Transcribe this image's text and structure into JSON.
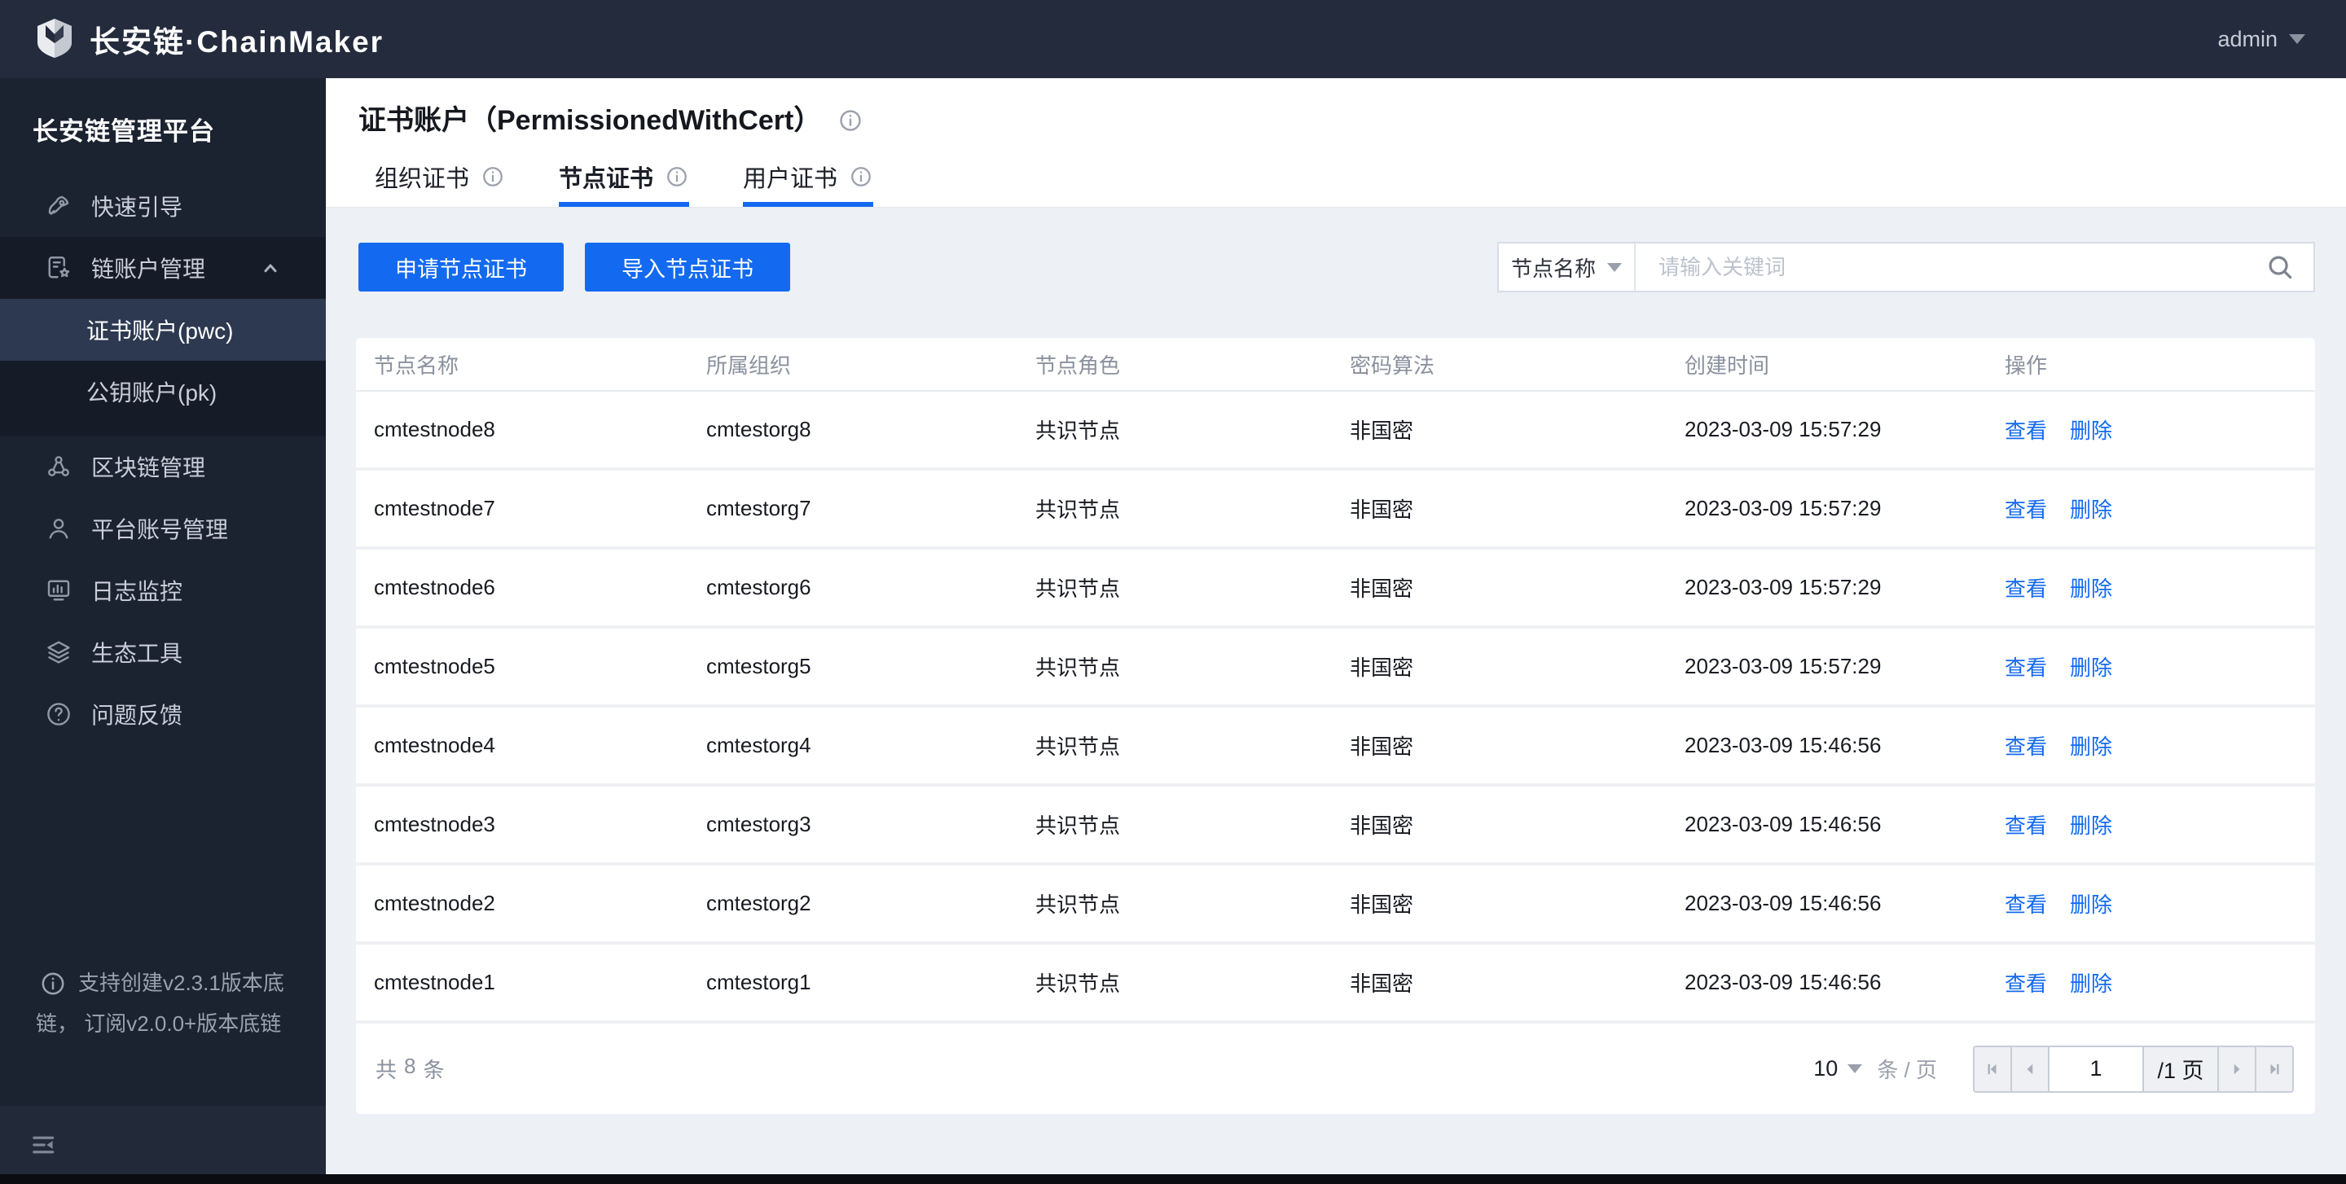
{
  "header": {
    "brand": "长安链·ChainMaker",
    "user": "admin"
  },
  "sidebar": {
    "title": "长安链管理平台",
    "items": [
      {
        "label": "快速引导",
        "icon": "rocket-icon"
      },
      {
        "label": "链账户管理",
        "icon": "chain-account-icon",
        "expanded": true,
        "children": [
          {
            "label": "证书账户(pwc)",
            "active": true
          },
          {
            "label": "公钥账户(pk)",
            "active": false
          }
        ]
      },
      {
        "label": "区块链管理",
        "icon": "blockchain-icon"
      },
      {
        "label": "平台账号管理",
        "icon": "platform-account-icon"
      },
      {
        "label": "日志监控",
        "icon": "log-monitor-icon"
      },
      {
        "label": "生态工具",
        "icon": "eco-tools-icon"
      },
      {
        "label": "问题反馈",
        "icon": "feedback-icon"
      }
    ],
    "footnote": "支持创建v2.3.1版本底链， 订阅v2.0.0+版本底链"
  },
  "main": {
    "title": "证书账户（PermissionedWithCert）",
    "tabs": [
      {
        "label": "组织证书",
        "active": false,
        "underline": false
      },
      {
        "label": "节点证书",
        "active": true,
        "underline": true
      },
      {
        "label": "用户证书",
        "active": false,
        "underline": true
      }
    ],
    "toolbar": {
      "apply_label": "申请节点证书",
      "import_label": "导入节点证书",
      "filter_value": "节点名称",
      "search_placeholder": "请输入关键词"
    },
    "table": {
      "columns": [
        "节点名称",
        "所属组织",
        "节点角色",
        "密码算法",
        "创建时间",
        "操作"
      ],
      "rows": [
        {
          "name": "cmtestnode8",
          "org": "cmtestorg8",
          "role": "共识节点",
          "algorithm": "非国密",
          "created": "2023-03-09 15:57:29"
        },
        {
          "name": "cmtestnode7",
          "org": "cmtestorg7",
          "role": "共识节点",
          "algorithm": "非国密",
          "created": "2023-03-09 15:57:29"
        },
        {
          "name": "cmtestnode6",
          "org": "cmtestorg6",
          "role": "共识节点",
          "algorithm": "非国密",
          "created": "2023-03-09 15:57:29"
        },
        {
          "name": "cmtestnode5",
          "org": "cmtestorg5",
          "role": "共识节点",
          "algorithm": "非国密",
          "created": "2023-03-09 15:57:29"
        },
        {
          "name": "cmtestnode4",
          "org": "cmtestorg4",
          "role": "共识节点",
          "algorithm": "非国密",
          "created": "2023-03-09 15:46:56"
        },
        {
          "name": "cmtestnode3",
          "org": "cmtestorg3",
          "role": "共识节点",
          "algorithm": "非国密",
          "created": "2023-03-09 15:46:56"
        },
        {
          "name": "cmtestnode2",
          "org": "cmtestorg2",
          "role": "共识节点",
          "algorithm": "非国密",
          "created": "2023-03-09 15:46:56"
        },
        {
          "name": "cmtestnode1",
          "org": "cmtestorg1",
          "role": "共识节点",
          "algorithm": "非国密",
          "created": "2023-03-09 15:46:56"
        }
      ],
      "actions": {
        "view": "查看",
        "delete": "删除"
      }
    },
    "pagination": {
      "total_label": "共",
      "total_count": "8",
      "total_unit": "条",
      "page_size": "10",
      "page_size_unit": "条 / 页",
      "current_page": "1",
      "total_pages_label": "/1 页"
    }
  },
  "colors": {
    "primary": "#136af0",
    "header_bg": "#232b3c",
    "sidebar_bg": "#1b2230",
    "sidebar_active_bg": "#2d3950",
    "page_bg": "#edf0f4"
  }
}
